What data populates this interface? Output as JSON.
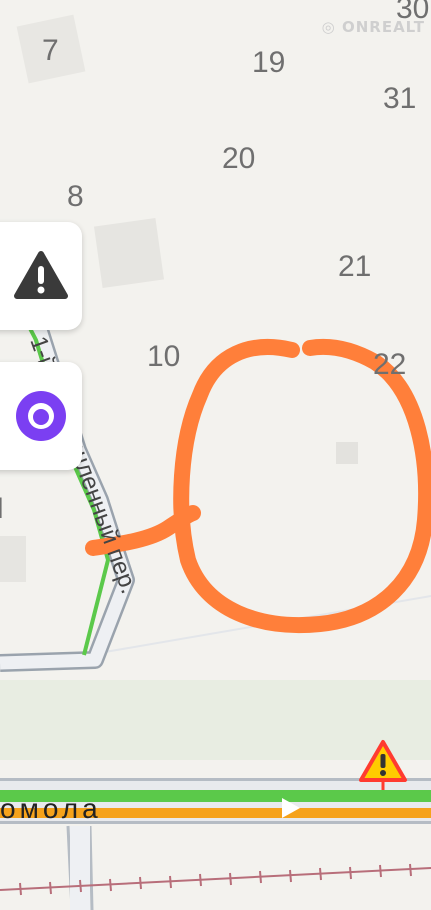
{
  "map": {
    "house_numbers": [
      "7",
      "19",
      "30",
      "31",
      "20",
      "8",
      "21",
      "10",
      "22"
    ],
    "side_street_label": "1-й промышленный пер.",
    "main_street_label": "омола",
    "watermark": "ONREALT",
    "partial_label": "I"
  },
  "controls": {
    "hazard_button_icon": "warning-triangle-icon",
    "assistant_button_icon": "alice-assistant-icon",
    "road_sign_icon": "warning-sign-icon"
  },
  "annotation": {
    "shape": "hand-drawn-circle",
    "color": "#ff7f3a"
  },
  "colors": {
    "background": "#f3f2ee",
    "green_route": "#5bc94a",
    "orange_route": "#f5a21b",
    "road_outline": "#9aa3ad"
  }
}
